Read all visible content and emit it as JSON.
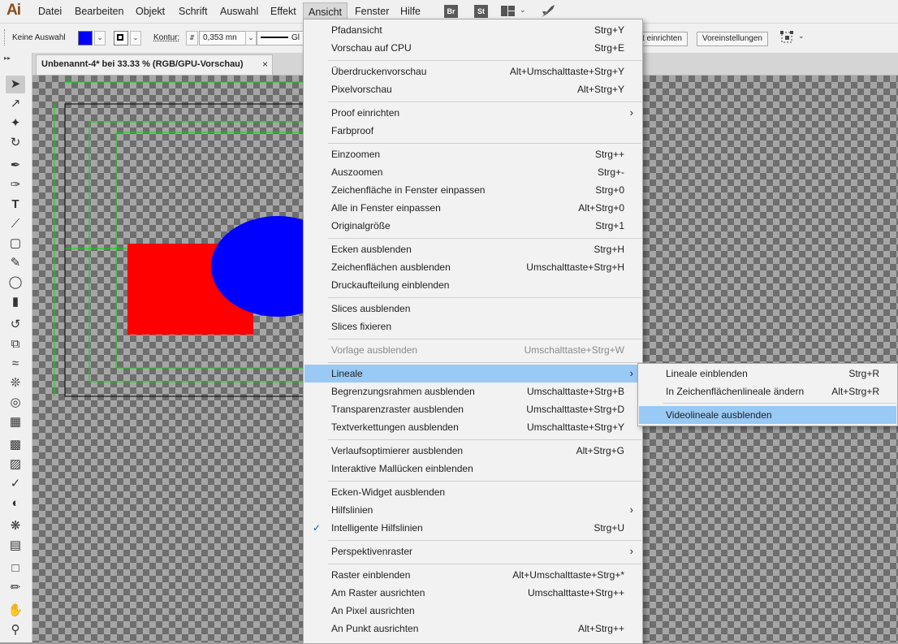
{
  "menubar": {
    "logo": "Ai",
    "items": [
      "Datei",
      "Bearbeiten",
      "Objekt",
      "Schrift",
      "Auswahl",
      "Effekt",
      "Ansicht",
      "Fenster",
      "Hilfe"
    ],
    "app_icons": [
      "Br",
      "St"
    ]
  },
  "control": {
    "selection_label": "Keine Auswahl",
    "fill_color": "#0000ff",
    "stroke_label": "Kontur:",
    "stroke_value": "0,353 mn",
    "brush_label": "Gl",
    "arrange_button": "t einrichten",
    "prefs_button": "Voreinstellungen"
  },
  "document": {
    "tab_title": "Unbenannt-4* bei 33.33 % (RGB/GPU-Vorschau)",
    "close": "×"
  },
  "artwork": {
    "rect_color": "#ff0000",
    "ellipse_color": "#0000ff",
    "guide_color": "#00dd00"
  },
  "ansicht_menu": {
    "items": [
      {
        "label": "Pfadansicht",
        "shortcut": "Strg+Y"
      },
      {
        "label": "Vorschau auf CPU",
        "shortcut": "Strg+E"
      },
      {
        "label": "Überdruckenvorschau",
        "shortcut": "Alt+Umschalttaste+Strg+Y"
      },
      {
        "label": "Pixelvorschau",
        "shortcut": "Alt+Strg+Y"
      },
      {
        "label": "Proof einrichten",
        "shortcut": ""
      },
      {
        "label": "Farbproof",
        "shortcut": ""
      },
      {
        "label": "Einzoomen",
        "shortcut": "Strg++"
      },
      {
        "label": "Auszoomen",
        "shortcut": "Strg+-"
      },
      {
        "label": "Zeichenfläche in Fenster einpassen",
        "shortcut": "Strg+0"
      },
      {
        "label": "Alle in Fenster einpassen",
        "shortcut": "Alt+Strg+0"
      },
      {
        "label": "Originalgröße",
        "shortcut": "Strg+1"
      },
      {
        "label": "Ecken ausblenden",
        "shortcut": "Strg+H"
      },
      {
        "label": "Zeichenflächen ausblenden",
        "shortcut": "Umschalttaste+Strg+H"
      },
      {
        "label": "Druckaufteilung einblenden",
        "shortcut": ""
      },
      {
        "label": "Slices ausblenden",
        "shortcut": ""
      },
      {
        "label": "Slices fixieren",
        "shortcut": ""
      },
      {
        "label": "Vorlage ausblenden",
        "shortcut": "Umschalttaste+Strg+W"
      },
      {
        "label": "Lineale",
        "shortcut": ""
      },
      {
        "label": "Begrenzungsrahmen ausblenden",
        "shortcut": "Umschalttaste+Strg+B"
      },
      {
        "label": "Transparenzraster ausblenden",
        "shortcut": "Umschalttaste+Strg+D"
      },
      {
        "label": "Textverkettungen ausblenden",
        "shortcut": "Umschalttaste+Strg+Y"
      },
      {
        "label": "Verlaufsoptimierer ausblenden",
        "shortcut": "Alt+Strg+G"
      },
      {
        "label": "Interaktive Mallücken einblenden",
        "shortcut": ""
      },
      {
        "label": "Ecken-Widget ausblenden",
        "shortcut": ""
      },
      {
        "label": "Hilfslinien",
        "shortcut": ""
      },
      {
        "label": "Intelligente Hilfslinien",
        "shortcut": "Strg+U"
      },
      {
        "label": "Perspektivenraster",
        "shortcut": ""
      },
      {
        "label": "Raster einblenden",
        "shortcut": "Alt+Umschalttaste+Strg+*"
      },
      {
        "label": "Am Raster ausrichten",
        "shortcut": "Umschalttaste+Strg++"
      },
      {
        "label": "An Pixel ausrichten",
        "shortcut": ""
      },
      {
        "label": "An Punkt ausrichten",
        "shortcut": "Alt+Strg++"
      }
    ]
  },
  "lineale_submenu": {
    "items": [
      {
        "label": "Lineale einblenden",
        "shortcut": "Strg+R"
      },
      {
        "label": "In Zeichenflächenlineale ändern",
        "shortcut": "Alt+Strg+R"
      },
      {
        "label": "Videolineale ausblenden",
        "shortcut": ""
      }
    ]
  }
}
